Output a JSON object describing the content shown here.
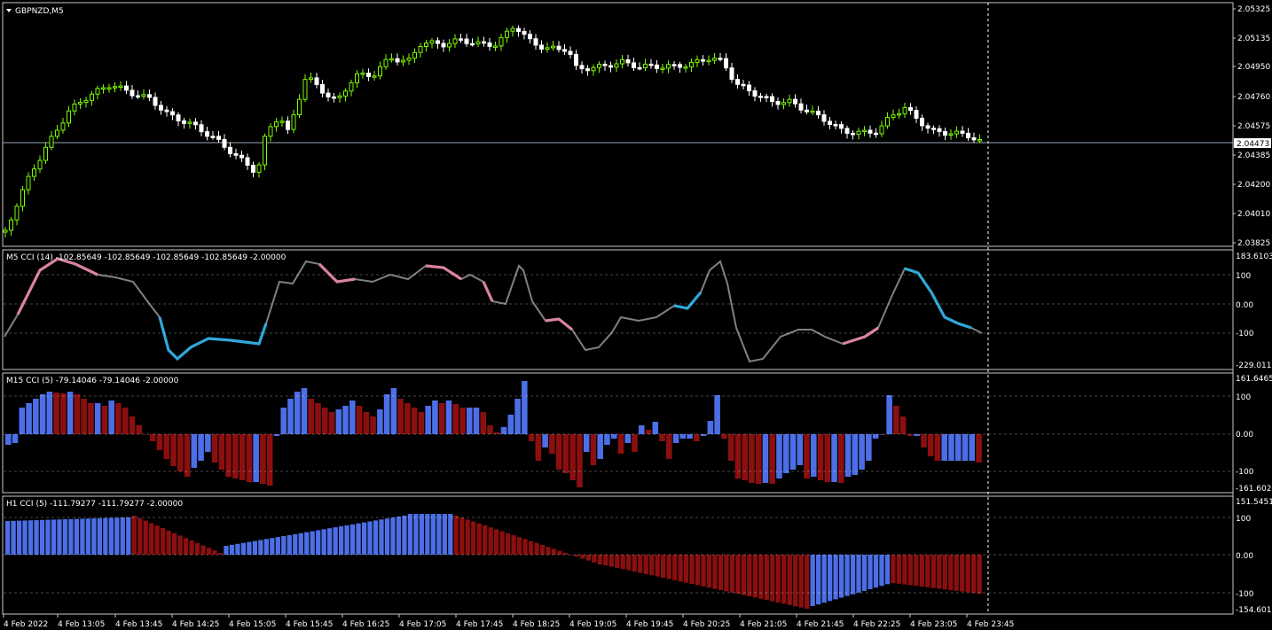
{
  "window": {
    "symbol_title": "GBPNZD,M5"
  },
  "main_chart": {
    "type": "candlestick",
    "price_scale": [
      "2.05325",
      "2.05135",
      "2.04950",
      "2.04760",
      "2.04575",
      "2.04385",
      "2.04200",
      "2.04010",
      "2.03825"
    ],
    "current_price": "2.04473",
    "ylim": [
      2.03825,
      2.05325
    ],
    "colors": {
      "bull": "#7CFC00",
      "bear": "#FFFFFF",
      "price_line": "#9aa7b5"
    }
  },
  "panels": [
    {
      "id": "m5",
      "label": "M5 CCI (14) -102.85649 -102.85649 -102.85649 -102.85649 -2.00000",
      "scale": [
        "183.61039",
        "100",
        "0.00",
        "-100",
        "-229.0113"
      ]
    },
    {
      "id": "m15",
      "label": "M15 CCI (5) -79.14046 -79.14046 -2.00000",
      "scale": [
        "161.6465",
        "100",
        "0.00",
        "-100",
        "-161.6023"
      ]
    },
    {
      "id": "h1",
      "label": "H1 CCI (5) -111.79277 -111.79277 -2.00000",
      "scale": [
        "151.5451",
        "100",
        "0.00",
        "-100",
        "-154.6015"
      ]
    }
  ],
  "time_axis": [
    "4 Feb 2022",
    "4 Feb 13:05",
    "4 Feb 13:45",
    "4 Feb 14:25",
    "4 Feb 15:05",
    "4 Feb 15:45",
    "4 Feb 16:25",
    "4 Feb 17:05",
    "4 Feb 17:45",
    "4 Feb 18:25",
    "4 Feb 19:05",
    "4 Feb 19:45",
    "4 Feb 20:25",
    "4 Feb 21:05",
    "4 Feb 21:45",
    "4 Feb 22:25",
    "4 Feb 23:05",
    "4 Feb 23:45"
  ],
  "colors": {
    "cci_line": "#808080",
    "cci_high": "#d9849c",
    "cci_low": "#2fa8d8",
    "hist_pos": "#4c6ee6",
    "hist_neg": "#8b0f0f",
    "grid": "#ffffff",
    "border": "#c8c8c8"
  }
}
